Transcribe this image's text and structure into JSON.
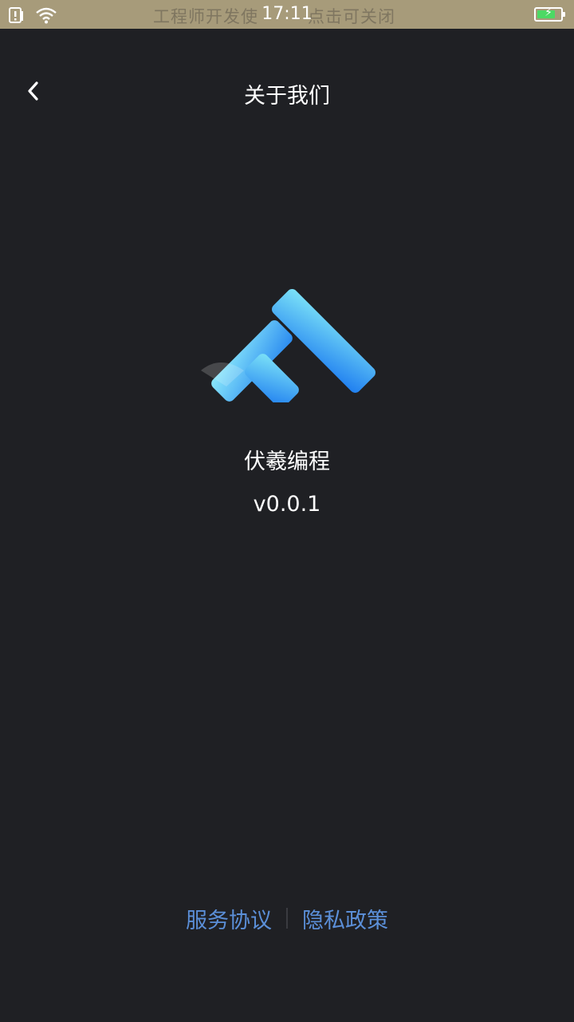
{
  "status_bar": {
    "time": "17:11",
    "notice": [
      "工程师开发使",
      "点击可关闭"
    ],
    "icons": [
      "sim-alert-icon",
      "wifi-icon",
      "battery-charging-icon"
    ],
    "battery_level_percent": 80
  },
  "nav": {
    "title": "关于我们",
    "back_icon": "chevron-left-icon"
  },
  "app": {
    "logo_icon": "app-logo",
    "name": "伏羲编程",
    "version": "v0.0.1"
  },
  "footer": {
    "service_agreement": "服务协议",
    "privacy_policy": "隐私政策"
  },
  "colors": {
    "background": "#1f2024",
    "status_bar": "#a79b7a",
    "link": "#5b8fd8",
    "logo_light": "#7de3f7",
    "logo_dark": "#1f7ef0"
  }
}
